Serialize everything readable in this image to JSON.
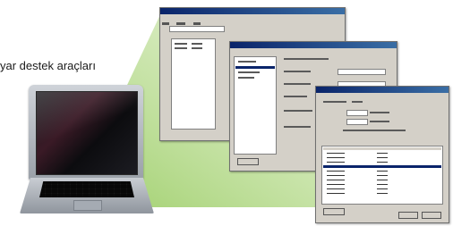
{
  "caption": {
    "text": "yar destek araçları"
  },
  "colors": {
    "beam": "#b9d98f",
    "titlebar": "#0a246a",
    "window_face": "#d4d0c8",
    "selection": "#0a246a"
  },
  "icons": [
    "laptop-icon"
  ]
}
